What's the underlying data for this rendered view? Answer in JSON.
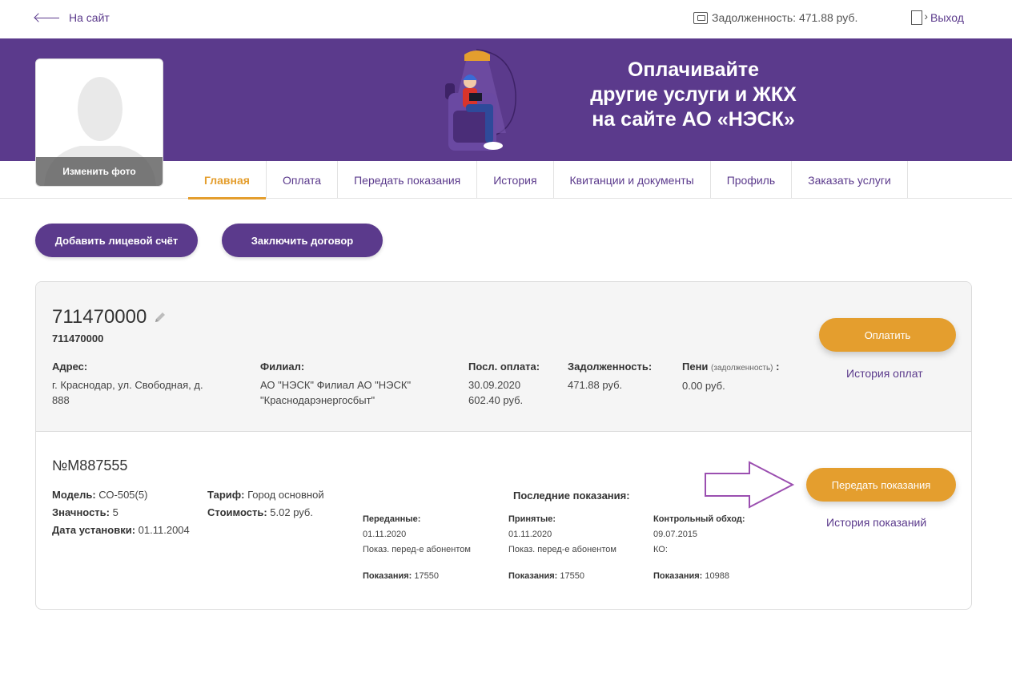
{
  "topbar": {
    "back_label": "На сайт",
    "debt_label": "Задолженность: 471.88 руб.",
    "logout_label": "Выход"
  },
  "banner": {
    "line1": "Оплачивайте",
    "line2": "другие услуги и ЖКХ",
    "line3": "на сайте АО «НЭСК»"
  },
  "avatar": {
    "change_label": "Изменить фото"
  },
  "tabs": [
    {
      "label": "Главная",
      "active": true
    },
    {
      "label": "Оплата"
    },
    {
      "label": "Передать показания"
    },
    {
      "label": "История"
    },
    {
      "label": "Квитанции и документы"
    },
    {
      "label": "Профиль"
    },
    {
      "label": "Заказать услуги"
    }
  ],
  "actions": {
    "add_account": "Добавить лицевой счёт",
    "contract": "Заключить договор"
  },
  "account": {
    "number": "711470000",
    "sub_number": "711470000",
    "address_label": "Адрес:",
    "address_line1": "г. Краснодар, ул. Свободная, д.",
    "address_line2": "888",
    "branch_label": "Филиал:",
    "branch_line1": "АО \"НЭСК\" Филиал АО \"НЭСК\"",
    "branch_line2": "\"Краснодарэнергосбыт\"",
    "last_pay_label": "Посл. оплата:",
    "last_pay_date": "30.09.2020",
    "last_pay_amount": "602.40 руб.",
    "debt_label": "Задолженность:",
    "debt_value": "471.88 руб.",
    "peni_label": "Пени",
    "peni_note": "(задолженность)",
    "peni_colon": ":",
    "peni_value": "0.00 руб.",
    "pay_button": "Оплатить",
    "pay_history": "История оплат"
  },
  "meter": {
    "number": "№M887555",
    "model_label": "Модель:",
    "model_value": "СО-505(5)",
    "digits_label": "Значность:",
    "digits_value": "5",
    "install_label": "Дата установки:",
    "install_value": "01.11.2004",
    "tariff_label": "Тариф:",
    "tariff_value": "Город основной",
    "cost_label": "Стоимость:",
    "cost_value": "5.02 руб.",
    "last_title": "Последние показания:",
    "transmitted": {
      "title": "Переданные:",
      "date": "01.11.2020",
      "note": "Показ. перед-е абонентом",
      "reading_label": "Показания:",
      "reading_value": "17550"
    },
    "accepted": {
      "title": "Принятые:",
      "date": "01.11.2020",
      "note": "Показ. перед-е абонентом",
      "reading_label": "Показания:",
      "reading_value": "17550"
    },
    "control": {
      "title": "Контрольный обход:",
      "date": "09.07.2015",
      "note": "КО:",
      "reading_label": "Показания:",
      "reading_value": "10988"
    },
    "transfer_button": "Передать показания",
    "readings_history": "История показаний"
  },
  "colors": {
    "brand_purple": "#5b3a8c",
    "accent_orange": "#e49e2e"
  }
}
